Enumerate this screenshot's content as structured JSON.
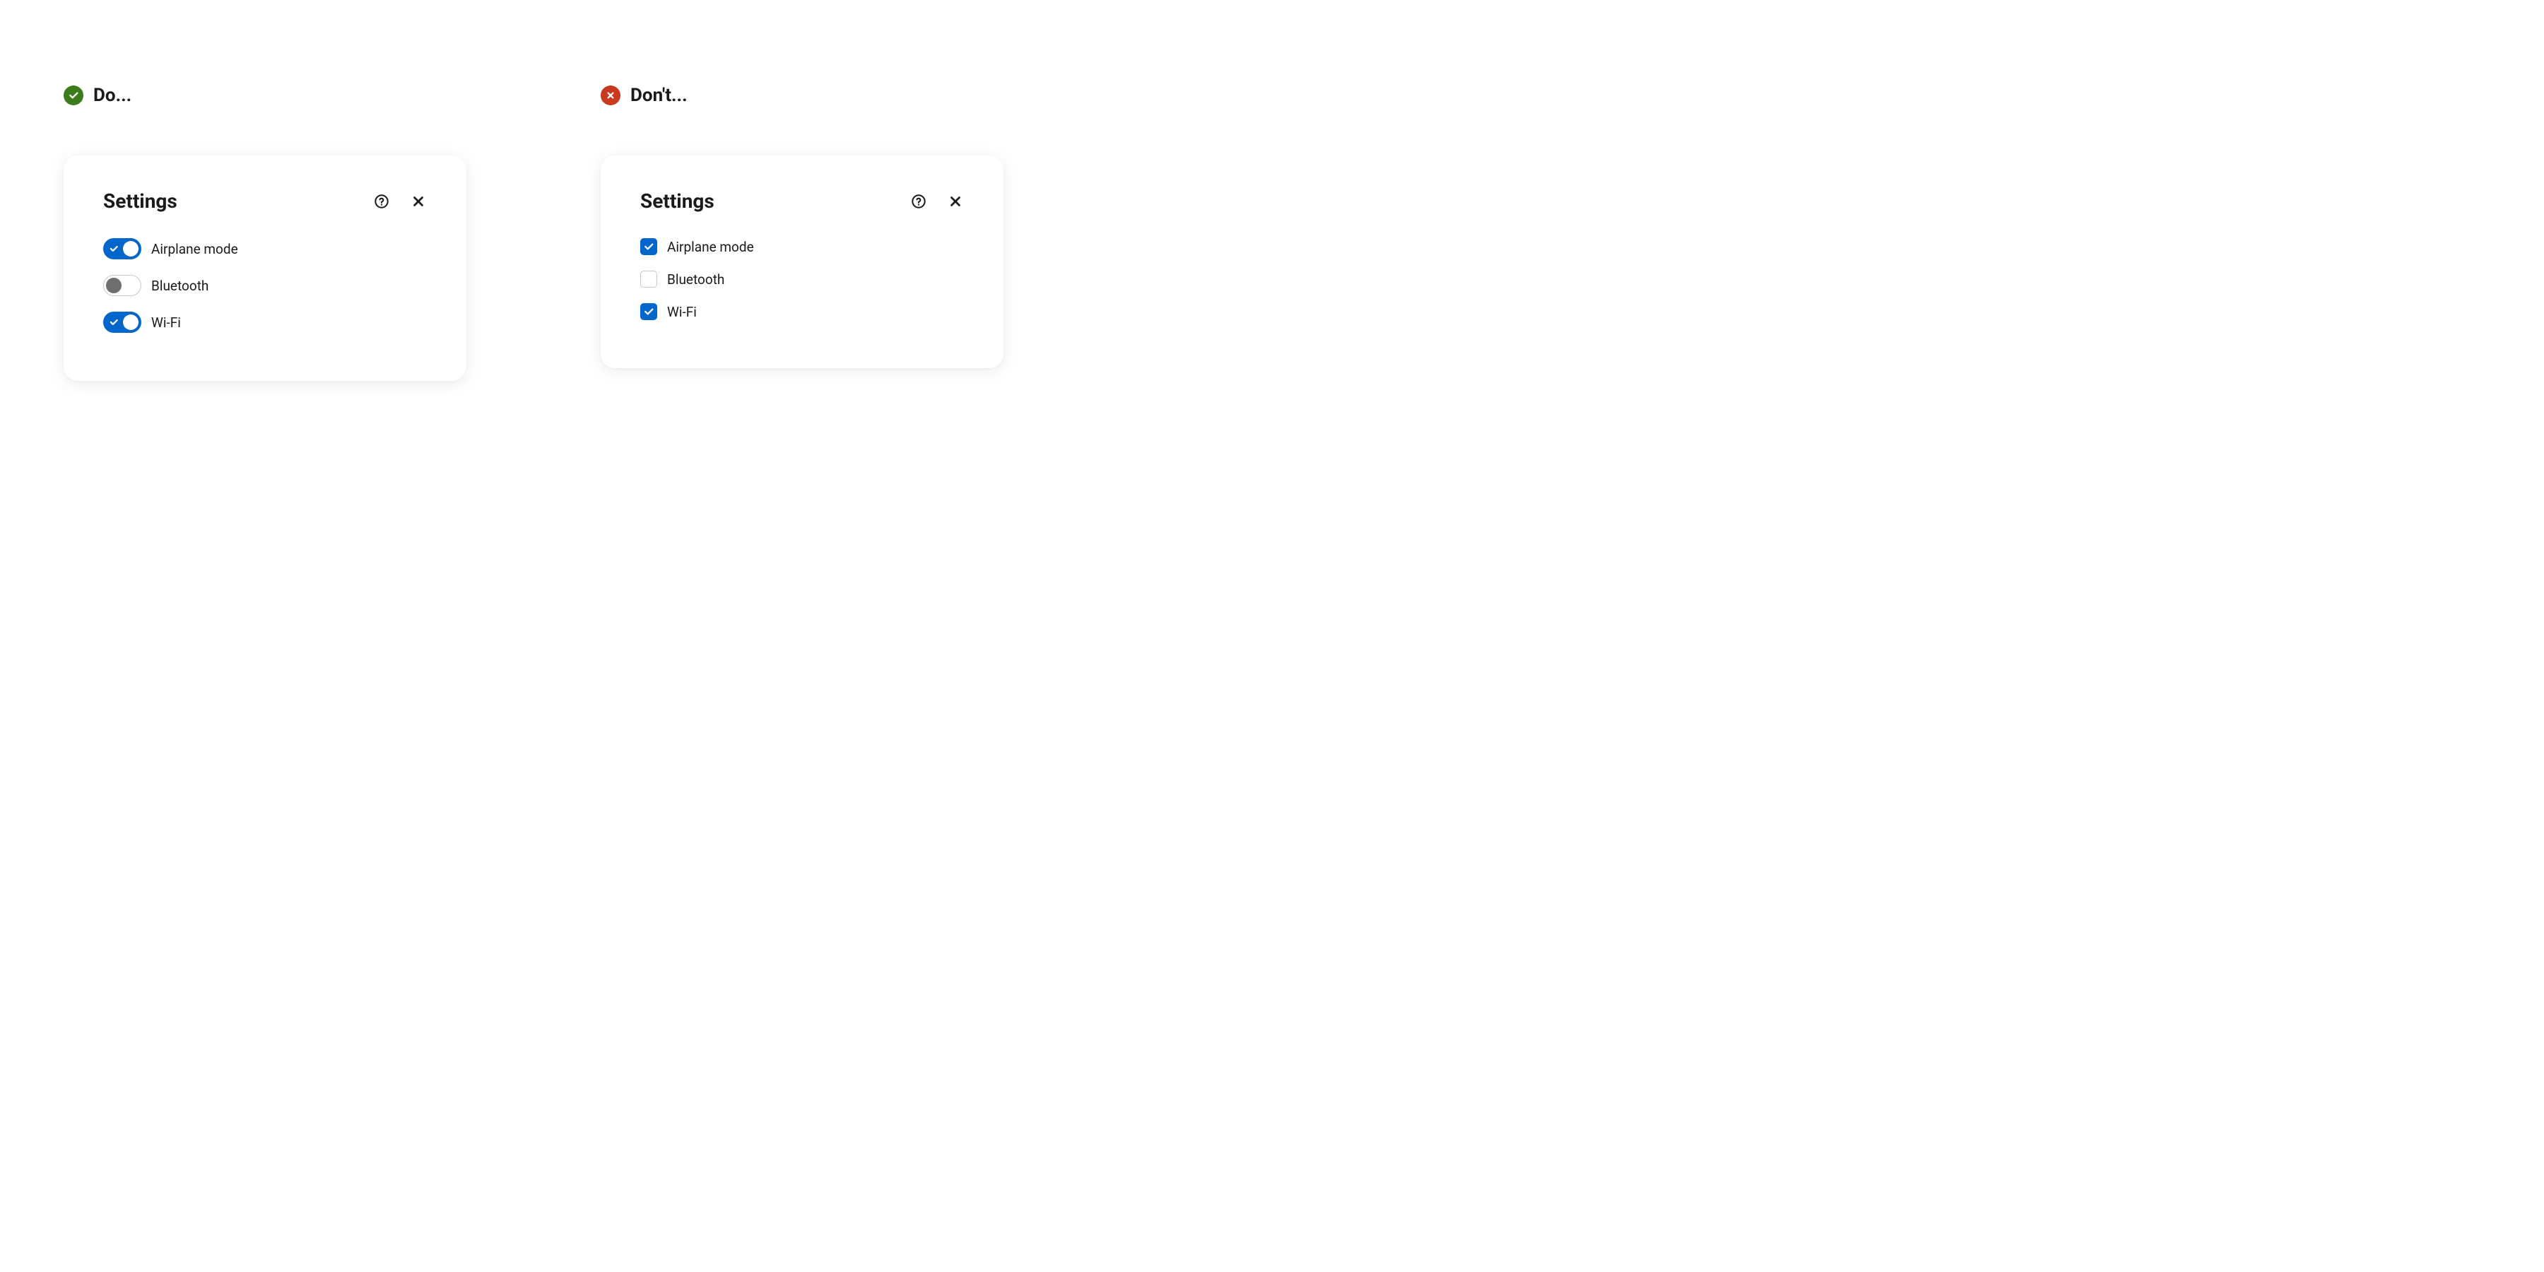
{
  "colors": {
    "primary": "#0066cc",
    "do": "#3d7c1a",
    "dont": "#c9391d"
  },
  "do_example": {
    "header": "Do...",
    "card": {
      "title": "Settings",
      "items": [
        {
          "label": "Airplane mode",
          "on": true
        },
        {
          "label": "Bluetooth",
          "on": false
        },
        {
          "label": "Wi-Fi",
          "on": true
        }
      ]
    }
  },
  "dont_example": {
    "header": "Don't...",
    "card": {
      "title": "Settings",
      "items": [
        {
          "label": "Airplane mode",
          "checked": true
        },
        {
          "label": "Bluetooth",
          "checked": false
        },
        {
          "label": "Wi-Fi",
          "checked": true
        }
      ]
    }
  }
}
